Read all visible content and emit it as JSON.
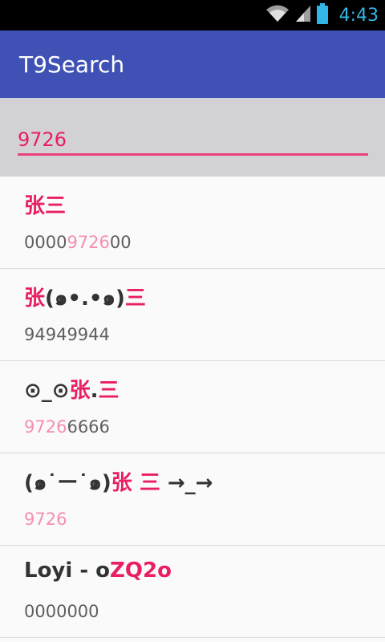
{
  "status_bar": {
    "time": "4:43",
    "icons": [
      "wifi-icon",
      "cell-signal-icon",
      "battery-icon"
    ],
    "time_color": "#33b5e5"
  },
  "app": {
    "title": "T9Search",
    "primary_color": "#3f51b5",
    "accent_color": "#e91e63"
  },
  "search": {
    "value": "9726",
    "placeholder": ""
  },
  "results": [
    {
      "name_parts": [
        {
          "text": "张三",
          "highlight": true
        }
      ],
      "number_parts": [
        {
          "text": "0000",
          "highlight": false
        },
        {
          "text": "9726",
          "highlight": true
        },
        {
          "text": "00",
          "highlight": false
        }
      ]
    },
    {
      "name_parts": [
        {
          "text": "张",
          "highlight": true
        },
        {
          "text": "(๑•.•๑)",
          "highlight": false
        },
        {
          "text": "三",
          "highlight": true
        }
      ],
      "number_parts": [
        {
          "text": "94949944",
          "highlight": false
        }
      ]
    },
    {
      "name_parts": [
        {
          "text": "⊙_⊙",
          "highlight": false
        },
        {
          "text": "张",
          "highlight": true
        },
        {
          "text": ".",
          "highlight": false
        },
        {
          "text": "三",
          "highlight": true
        }
      ],
      "number_parts": [
        {
          "text": "9726",
          "highlight": true
        },
        {
          "text": "6666",
          "highlight": false
        }
      ]
    },
    {
      "name_parts": [
        {
          "text": "(๑˙ー˙๑)",
          "highlight": false
        },
        {
          "text": "张 三",
          "highlight": true
        },
        {
          "text": " →_→",
          "highlight": false
        }
      ],
      "number_parts": [
        {
          "text": "9726",
          "highlight": true
        }
      ]
    },
    {
      "name_parts": [
        {
          "text": "Loyi - o",
          "highlight": false
        },
        {
          "text": "ZQ2o",
          "highlight": true
        }
      ],
      "number_parts": [
        {
          "text": "0000000",
          "highlight": false
        }
      ]
    }
  ]
}
